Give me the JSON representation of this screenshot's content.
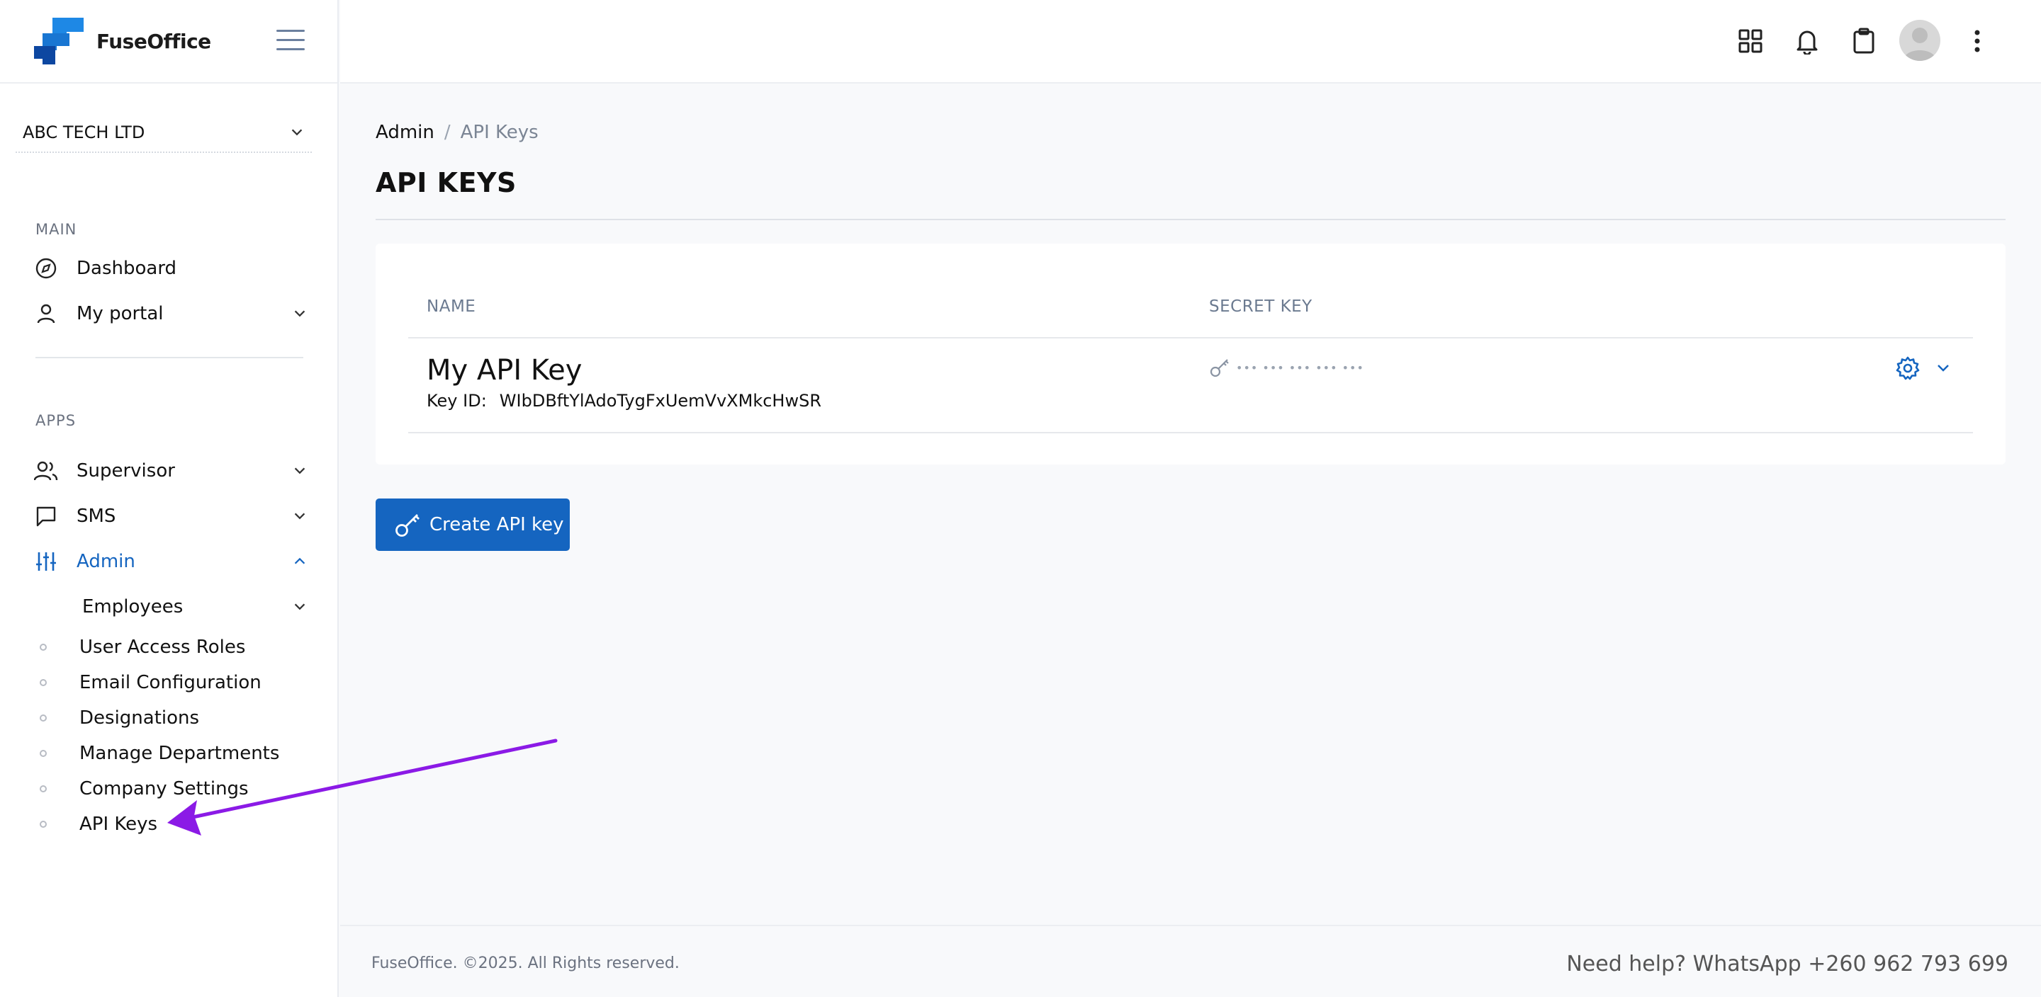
{
  "brand": {
    "name": "FuseOffice"
  },
  "company": {
    "label": "ABC TECH LTD"
  },
  "sidebar": {
    "main_label": "MAIN",
    "apps_label": "APPS",
    "main_items": [
      {
        "label": "Dashboard",
        "icon": "compass-icon"
      },
      {
        "label": "My portal",
        "icon": "user-icon"
      }
    ],
    "app_items": [
      {
        "label": "Supervisor",
        "icon": "users-icon"
      },
      {
        "label": "SMS",
        "icon": "message-icon"
      },
      {
        "label": "Admin",
        "icon": "sliders-icon"
      }
    ],
    "admin_sub": {
      "employees": "Employees",
      "items": [
        "User Access Roles",
        "Email Configuration",
        "Designations",
        "Manage Departments",
        "Company Settings",
        "API Keys"
      ]
    }
  },
  "breadcrumb": {
    "parent": "Admin",
    "separator": "/",
    "current": "API Keys"
  },
  "page": {
    "title": "API KEYS"
  },
  "table": {
    "col_name": "NAME",
    "col_secret": "SECRET KEY",
    "rows": [
      {
        "name": "My API Key",
        "key_id_label": "Key ID:",
        "key_id": "WIbDBftYlAdoTygFxUemVvXMkcHwSR",
        "secret_mask": "••• ••• ••• ••• •••"
      }
    ]
  },
  "actions": {
    "create_label": "Create API key"
  },
  "footer": {
    "copyright": "FuseOffice. ©2025. All Rights reserved.",
    "help": "Need help? WhatsApp +260 962 793 699"
  },
  "colors": {
    "accent": "#1565c0",
    "annotation_arrow": "#8b1ae6"
  }
}
